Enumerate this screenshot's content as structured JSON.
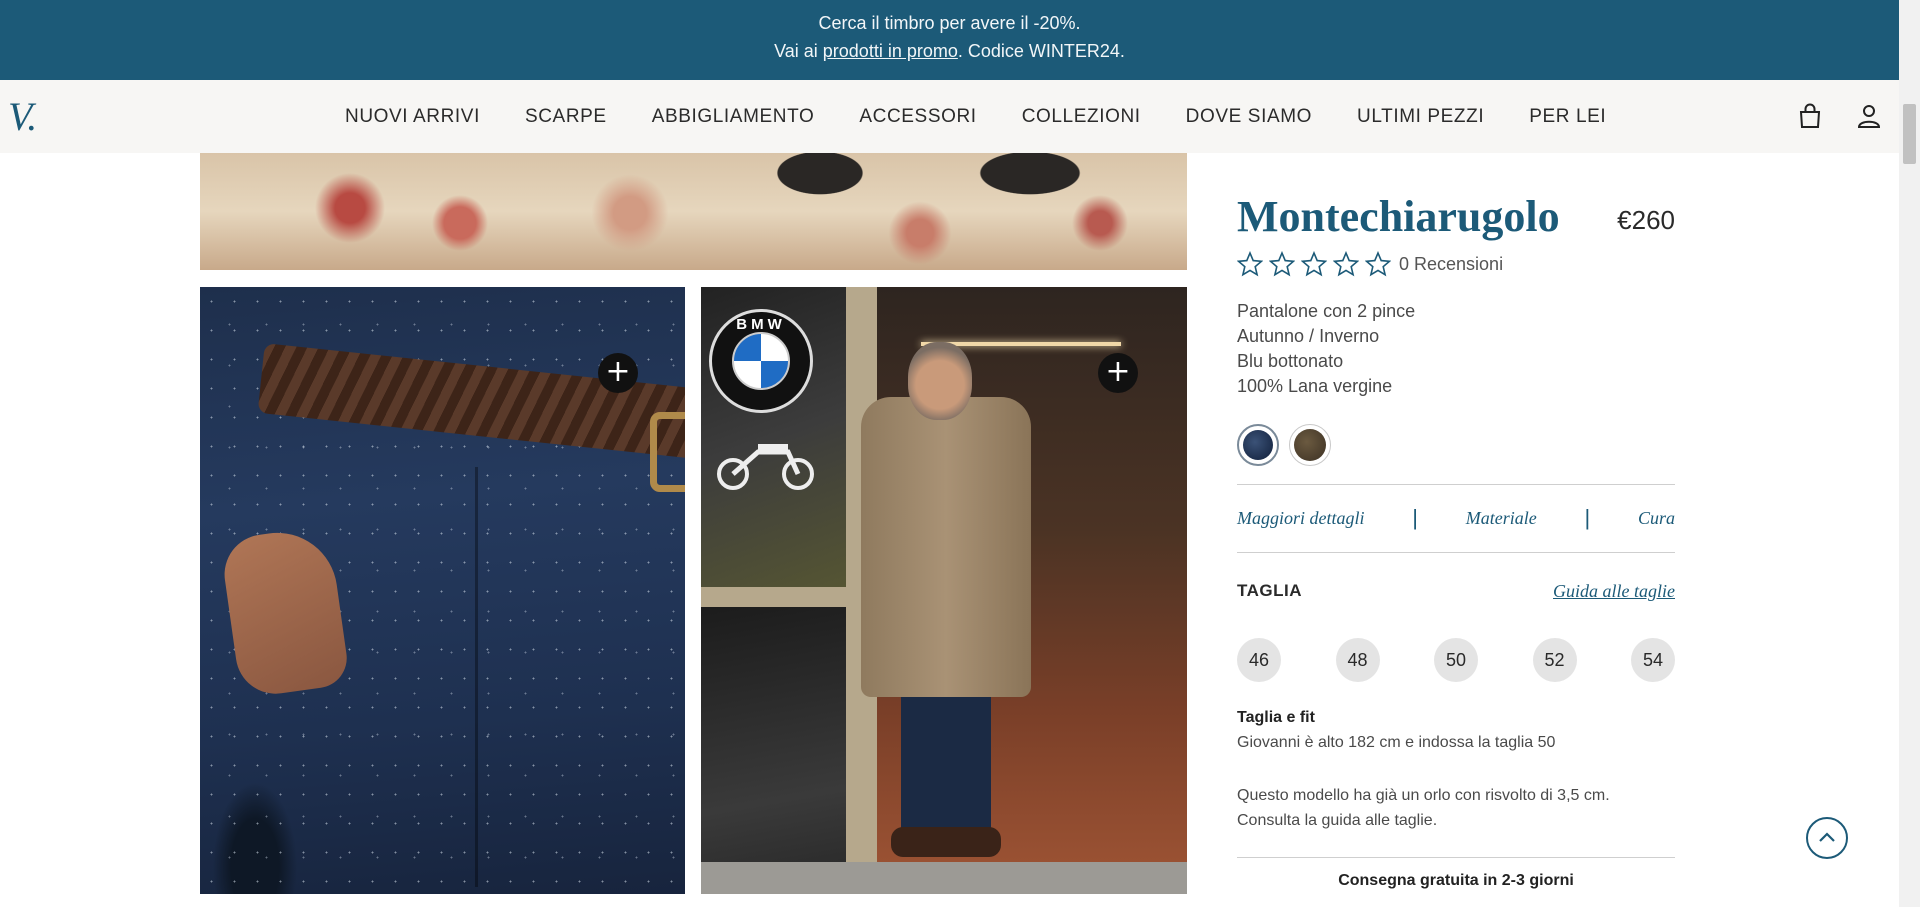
{
  "promo": {
    "line1": "Cerca il timbro per avere il -20%.",
    "line2_prefix": "Vai ai ",
    "line2_link": "prodotti in promo",
    "line2_suffix": ". Codice WINTER24."
  },
  "header": {
    "logo_text": "V.",
    "nav": [
      "NUOVI ARRIVI",
      "SCARPE",
      "ABBIGLIAMENTO",
      "ACCESSORI",
      "COLLEZIONI",
      "DOVE SIAMO",
      "ULTIMI PEZZI",
      "PER LEI"
    ],
    "icons": [
      "cart-icon",
      "account-icon"
    ]
  },
  "gallery": {
    "bmw_text": "BMW",
    "zoom_symbol": "+"
  },
  "product": {
    "title": "Montechiarugolo",
    "price": "€260",
    "rating": 0,
    "rating_max": 5,
    "reviews": "0 Recensioni",
    "description": [
      "Pantalone con 2 pince",
      "Autunno / Inverno",
      "Blu bottonato",
      "100% Lana vergine"
    ],
    "swatches": [
      {
        "color": "#1d2e4c",
        "selected": true
      },
      {
        "color": "#4a3d2c",
        "selected": false
      }
    ],
    "tabs": [
      "Maggiori dettagli",
      "Materiale",
      "Cura"
    ],
    "tab_separator": "|",
    "size_label": "TAGLIA",
    "size_guide": "Guida alle taglie",
    "sizes": [
      "46",
      "48",
      "50",
      "52",
      "54"
    ],
    "fit_title": "Taglia e fit",
    "fit_text": "Giovanni è alto 182 cm e indossa la taglia 50",
    "hem_text": "Questo modello ha già un orlo con risvolto di 3,5 cm. Consulta la guida alle taglie.",
    "delivery": "Consegna gratuita in 2-3 giorni"
  },
  "colors": {
    "brand": "#1c5a78",
    "header_bg": "#f7f6f4"
  }
}
